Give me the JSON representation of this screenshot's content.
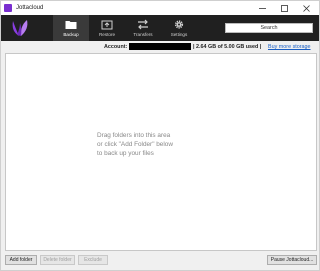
{
  "window": {
    "title": "Jottacloud"
  },
  "toolbar": {
    "tabs": [
      {
        "label": "Backup",
        "icon": "folder-icon"
      },
      {
        "label": "Restore",
        "icon": "restore-icon"
      },
      {
        "label": "Transfers",
        "icon": "transfers-icon"
      },
      {
        "label": "Settings",
        "icon": "gear-icon"
      }
    ],
    "search_value": "Search"
  },
  "account": {
    "label": "Account:",
    "storage": "| 2.64 GB of 5.00 GB used |",
    "buy_link": "Buy more storage"
  },
  "main": {
    "placeholder_lines": [
      "Drag folders into this area",
      "or click \"Add Folder\" below",
      "to back up your files"
    ]
  },
  "buttons": {
    "add_folder": "Add folder",
    "delete_folder": "Delete folder",
    "exclude": "Exclude",
    "pause": "Pause Jottacloud..."
  },
  "colors": {
    "toolbar_bg": "#202020",
    "active_tab_bg": "#3a3a3a",
    "logo_purple": "#8a3ee0",
    "link_blue": "#1a5fc4"
  }
}
